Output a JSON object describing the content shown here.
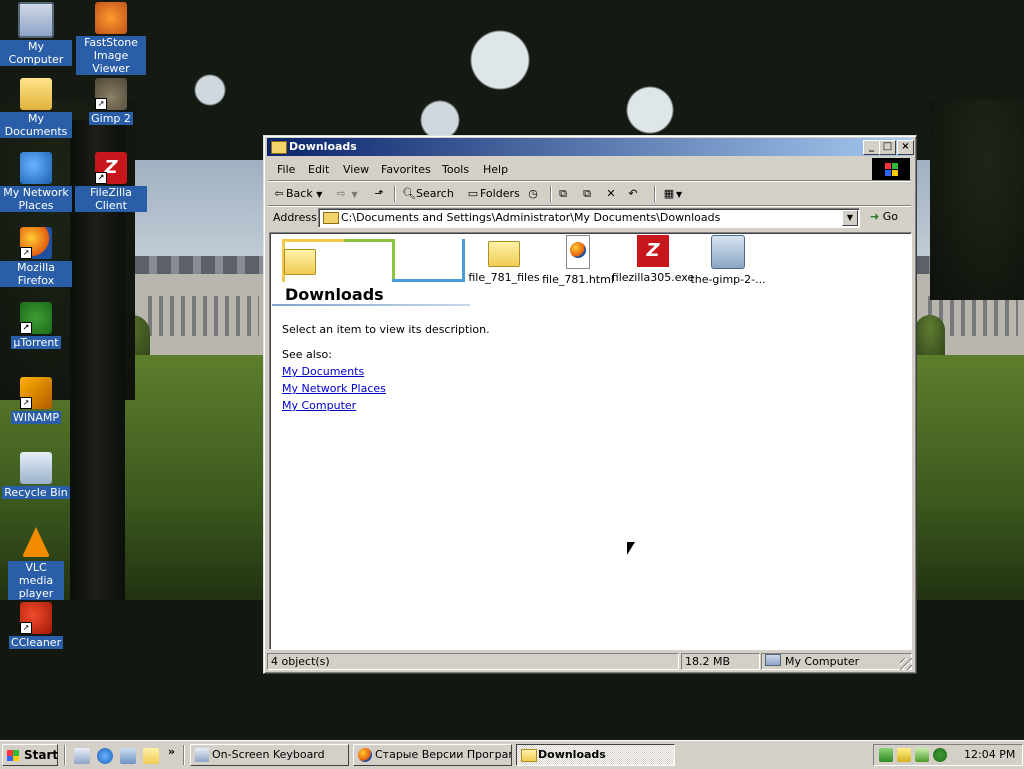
{
  "desktop": {
    "icons_left": [
      {
        "label": "My Computer",
        "icon": "my-computer-icon"
      },
      {
        "label": "My Documents",
        "icon": "my-documents-icon"
      },
      {
        "label": "My Network Places",
        "icon": "network-places-icon"
      },
      {
        "label": "Mozilla Firefox",
        "icon": "firefox-icon"
      },
      {
        "label": "µTorrent",
        "icon": "utorrent-icon"
      },
      {
        "label": "WINAMP",
        "icon": "winamp-icon"
      },
      {
        "label": "Recycle Bin",
        "icon": "recycle-bin-icon"
      },
      {
        "label": "VLC media player",
        "icon": "vlc-icon"
      },
      {
        "label": "CCleaner",
        "icon": "ccleaner-icon"
      }
    ],
    "icons_right": [
      {
        "label": "FastStone Image Viewer",
        "icon": "faststone-icon"
      },
      {
        "label": "Gimp 2",
        "icon": "gimp-icon"
      },
      {
        "label": "FileZilla Client",
        "icon": "filezilla-icon"
      }
    ],
    "shortcut_glyph": "↗"
  },
  "window": {
    "title": "Downloads",
    "controls": {
      "minimize": "_",
      "maximize": "□",
      "close": "×"
    },
    "menu": [
      "File",
      "Edit",
      "View",
      "Favorites",
      "Tools",
      "Help"
    ],
    "toolbar": {
      "back": "Back",
      "search": "Search",
      "folders": "Folders"
    },
    "address": {
      "label": "Address",
      "path": "C:\\Documents and Settings\\Administrator\\My Documents\\Downloads",
      "go": "Go"
    },
    "sidebar": {
      "title": "Downloads",
      "description": "Select an item to view its description.",
      "see_also": "See also:",
      "links": [
        "My Documents",
        "My Network Places",
        "My Computer"
      ]
    },
    "files": [
      {
        "name": "file_781_files",
        "icon": "folder-icon"
      },
      {
        "name": "file_781.html",
        "icon": "firefox-html-icon"
      },
      {
        "name": "filezilla305.exe",
        "icon": "filezilla-exe-icon"
      },
      {
        "name": "the-gimp-2-...",
        "icon": "setup-icon"
      }
    ],
    "status": {
      "objects": "4 object(s)",
      "size": "18.2 MB",
      "zone": "My Computer"
    }
  },
  "taskbar": {
    "start": "Start",
    "tasks": [
      {
        "label": "On-Screen Keyboard",
        "active": false
      },
      {
        "label": "Старые Версии Програм...",
        "active": false
      },
      {
        "label": "Downloads",
        "active": true
      }
    ],
    "clock": "12:04 PM",
    "quicklaunch_more": "»"
  }
}
